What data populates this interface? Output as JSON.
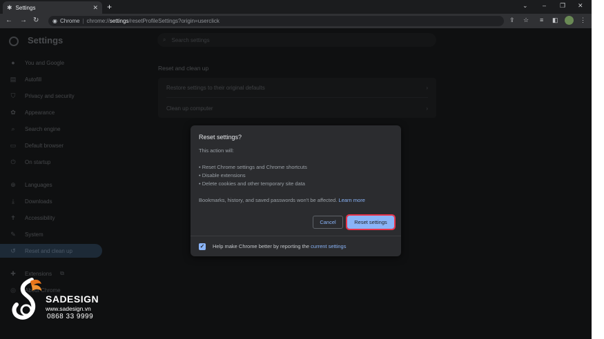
{
  "tab": {
    "title": "Settings",
    "icon": "gear-icon",
    "close": "✕"
  },
  "toolbar": {
    "site_label": "Chrome",
    "url_scheme": "chrome://",
    "url_host": "settings",
    "url_path": "/resetProfileSettings?origin=userclick"
  },
  "app": {
    "title": "Settings"
  },
  "search": {
    "placeholder": "Search settings"
  },
  "sidebar": {
    "items": [
      {
        "label": "You and Google",
        "icon": "person-icon"
      },
      {
        "label": "Autofill",
        "icon": "clipboard-icon"
      },
      {
        "label": "Privacy and security",
        "icon": "shield-icon"
      },
      {
        "label": "Appearance",
        "icon": "palette-icon"
      },
      {
        "label": "Search engine",
        "icon": "search-icon"
      },
      {
        "label": "Default browser",
        "icon": "browser-icon"
      },
      {
        "label": "On startup",
        "icon": "power-icon"
      },
      {
        "label": "Languages",
        "icon": "globe-icon"
      },
      {
        "label": "Downloads",
        "icon": "download-icon"
      },
      {
        "label": "Accessibility",
        "icon": "accessibility-icon"
      },
      {
        "label": "System",
        "icon": "wrench-icon"
      },
      {
        "label": "Reset and clean up",
        "icon": "restore-icon",
        "active": true
      },
      {
        "label": "Extensions",
        "icon": "puzzle-icon"
      },
      {
        "label": "About Chrome",
        "icon": "chrome-icon"
      }
    ]
  },
  "main": {
    "section_title": "Reset and clean up",
    "rows": [
      {
        "label": "Restore settings to their original defaults"
      },
      {
        "label": "Clean up computer"
      }
    ]
  },
  "dialog": {
    "title": "Reset settings?",
    "intro": "This action will:",
    "bullets": [
      "• Reset Chrome settings and Chrome shortcuts",
      "• Disable extensions",
      "• Delete cookies and other temporary site data"
    ],
    "note": "Bookmarks, history, and saved passwords won't be affected.",
    "learn_more": "Learn more",
    "cancel_label": "Cancel",
    "reset_label": "Reset settings",
    "footer_text": "Help make Chrome better by reporting the",
    "footer_link": "current settings",
    "footer_checked": true
  },
  "watermark": {
    "name": "SADESIGN",
    "url": "www.sadesign.vn",
    "phone": "0868 33 9999"
  },
  "colors": {
    "accent": "#8ab4f8",
    "highlight": "#e8334a",
    "dialog_bg": "#2b2c2f"
  }
}
